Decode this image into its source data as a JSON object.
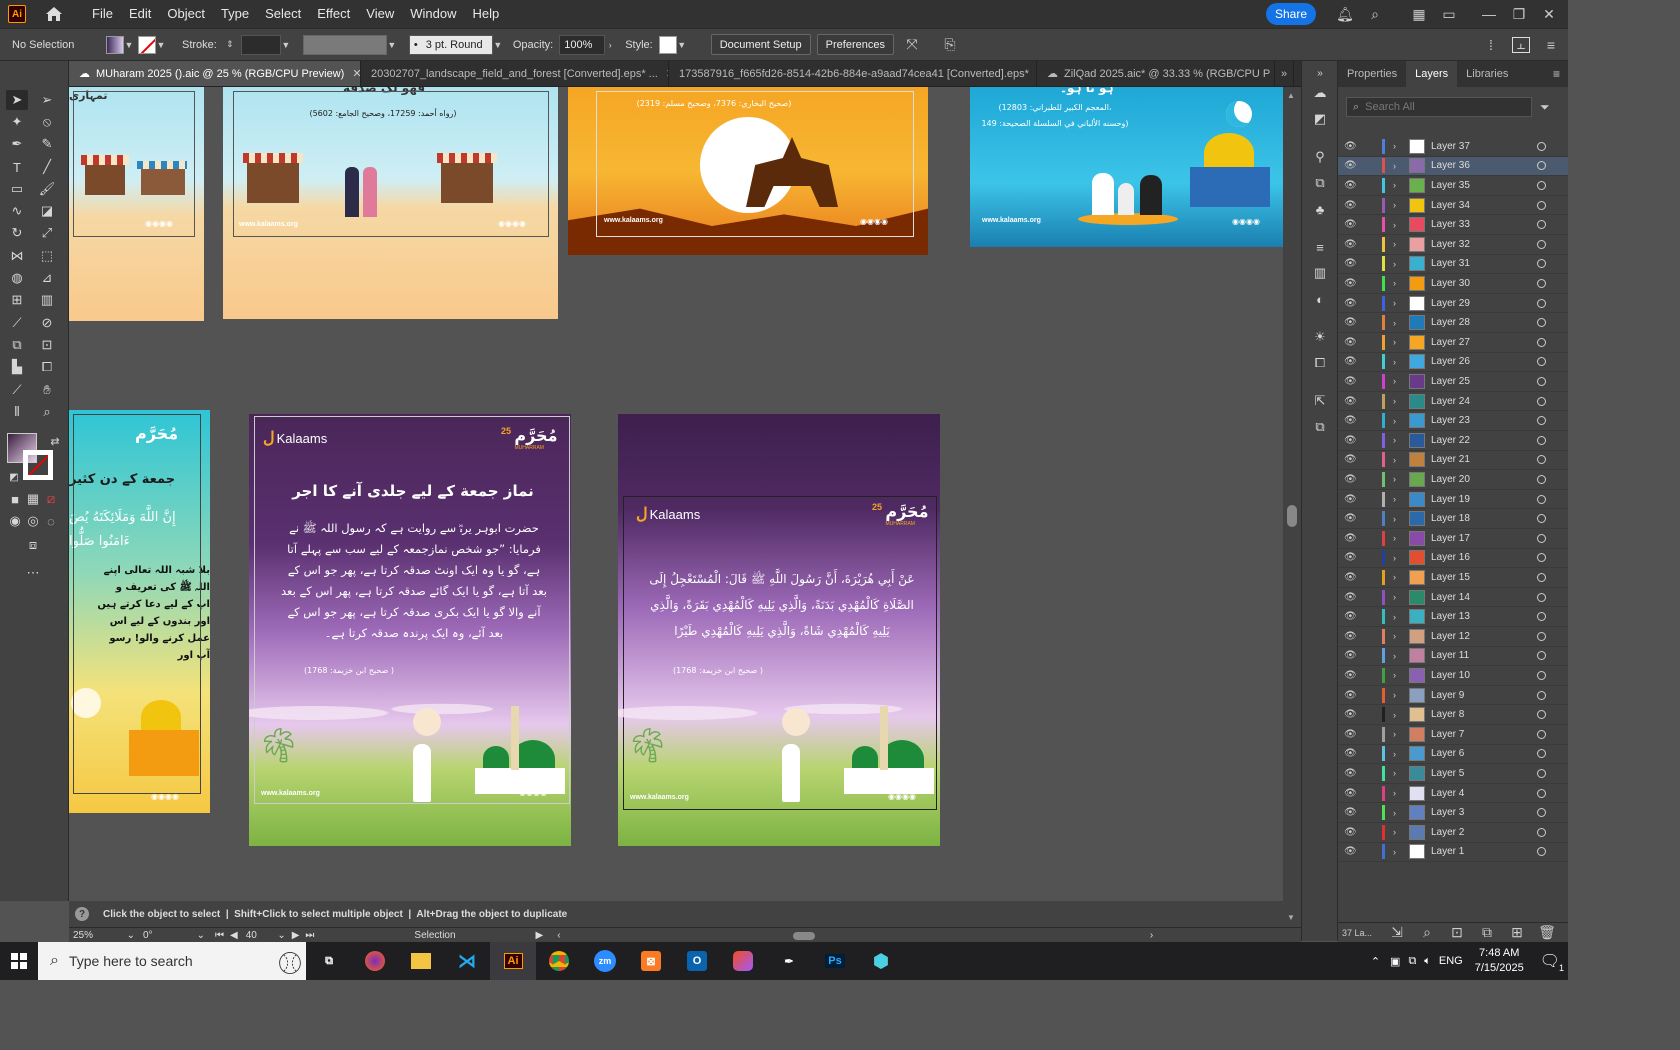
{
  "app": {
    "logo": "Ai",
    "menus": [
      "File",
      "Edit",
      "Object",
      "Type",
      "Select",
      "Effect",
      "View",
      "Window",
      "Help"
    ],
    "share_label": "Share"
  },
  "control_bar": {
    "selection": "No Selection",
    "stroke_label": "Stroke:",
    "brush_value": "3 pt. Round",
    "opacity_label": "Opacity:",
    "opacity_value": "100%",
    "style_label": "Style:",
    "document_setup": "Document Setup",
    "preferences": "Preferences"
  },
  "tabs": [
    {
      "label": "MUharam 2025 ().aic @ 25 % (RGB/CPU Preview)",
      "active": true
    },
    {
      "label": "20302707_landscape_field_and_forest [Converted].eps* ...",
      "active": false
    },
    {
      "label": "173587916_f665fd26-8514-42b6-884e-a9aad74cea41 [Converted].eps*",
      "active": false
    },
    {
      "label": "ZilQad 2025.aic* @ 33.33 % (RGB/CPU P",
      "active": false
    }
  ],
  "artboards": {
    "ab2_title": "فهو لک صدقة",
    "ab2_ref": "(رواه أحمد: 17259، وصحيح الجامع: 5602)",
    "ab1_title": "تمہاری",
    "ab3_ref": "(صحيح البخاري: 7376، وصحيح مسلم: 2319)",
    "ab4_title": "ہو تا ہو۔",
    "ab4_ref1": "(المعجم الكبير للطبراني: 12803،",
    "ab4_ref2": "وحسنه الألباني في السلسلة الصحيحة: 149)",
    "url": "www.kalaams.org",
    "brand": "Kalaams",
    "muharram": "مُحَرَّم",
    "muharram_sub": "MUHARRAM",
    "number": "25",
    "ab5_heading": "جمعة کے دن کثیر",
    "ab5_arabic1": "إِنَّ اللَّهَ وَمَلَائِكَتَهُ يُصَ",
    "ab5_arabic2": "ءَامَنُوا صَلُّوا",
    "ab5_body": "بلا شبہ اللہ تعالی اپنے\nاللہ ﷺ کی تعریف و\nاپ کے لیے دعا کرتے ہیں\nاور بندوں کے لیے اس\nعمل کرنے والو! رسو\nآپ اور",
    "ab6_heading": "نماز جمعة کے لیے جلدی آنے کا اجر",
    "ab6_body": "حضرت ابوہر یرہؓ سے روایت ہے کہ رسول اللہ ﷺ نے فرمایا: ”جو شخص نمازجمعہ کے لیے سب سے پہلے آتا ہے، گو یا وہ ایک اونٹ صدقہ کرتا ہے، پھر جو اس کے بعد آتا ہے، گو یا ایک گائے صدقہ کرتا ہے، پھر اس کے بعد آنے والا گو یا ایک بکری صدقہ کرتا ہے، پھر جو اس کے بعد آئے، وہ ایک پرندہ صدقہ کرتا ہے۔",
    "ab6_ref": "(صحيح ابن خزيمة: 1768 )",
    "ab7_arabic": "عَنْ أَبِي هُرَيْرَةَ، أَنَّ رَسُولَ اللَّهِ ﷺ قَالَ: الْمُسْتَعْجِلُ إِلَى الصَّلَاةِ كَالْمُهْدِي بَدَنَةً، وَالَّذِي يَلِيهِ كَالْمُهْدِي بَقَرَةً، وَالَّذِي يَلِيهِ كَالْمُهْدِي شَاةً، وَالَّذِي يَلِيهِ كَالْمُهْدِي طَيْرًا",
    "ab7_ref": "(صحيح ابن خزيمة: 1768 )"
  },
  "panel": {
    "tabs": [
      "Properties",
      "Layers",
      "Libraries"
    ],
    "active_tab": "Layers",
    "search_placeholder": "Search All",
    "layers": [
      {
        "name": "Layer 37",
        "color": "#4a7fe0"
      },
      {
        "name": "Layer 36",
        "color": "#e05050",
        "selected": true
      },
      {
        "name": "Layer 35",
        "color": "#40c8e0"
      },
      {
        "name": "Layer 34",
        "color": "#9b59b6"
      },
      {
        "name": "Layer 33",
        "color": "#e84fa8"
      },
      {
        "name": "Layer 32",
        "color": "#f0c040"
      },
      {
        "name": "Layer 31",
        "color": "#e0e040"
      },
      {
        "name": "Layer 30",
        "color": "#40e050"
      },
      {
        "name": "Layer 29",
        "color": "#4060e0"
      },
      {
        "name": "Layer 28",
        "color": "#e08040"
      },
      {
        "name": "Layer 27",
        "color": "#f0a030"
      },
      {
        "name": "Layer 26",
        "color": "#40d0d0"
      },
      {
        "name": "Layer 25",
        "color": "#d040d0"
      },
      {
        "name": "Layer 24",
        "color": "#c0a060"
      },
      {
        "name": "Layer 23",
        "color": "#30b0d0"
      },
      {
        "name": "Layer 22",
        "color": "#8060e0"
      },
      {
        "name": "Layer 21",
        "color": "#e06090"
      },
      {
        "name": "Layer 20",
        "color": "#70c070"
      },
      {
        "name": "Layer 19",
        "color": "#b0b0b0"
      },
      {
        "name": "Layer 18",
        "color": "#5080c0"
      },
      {
        "name": "Layer 17",
        "color": "#e04040"
      },
      {
        "name": "Layer 16",
        "color": "#2040a0"
      },
      {
        "name": "Layer 15",
        "color": "#e0a020"
      },
      {
        "name": "Layer 14",
        "color": "#9050c0"
      },
      {
        "name": "Layer 13",
        "color": "#30c0c0"
      },
      {
        "name": "Layer 12",
        "color": "#e08060"
      },
      {
        "name": "Layer 11",
        "color": "#60a0e0"
      },
      {
        "name": "Layer 10",
        "color": "#40a040"
      },
      {
        "name": "Layer 9",
        "color": "#e06030"
      },
      {
        "name": "Layer 8",
        "color": "#202020"
      },
      {
        "name": "Layer 7",
        "color": "#a0a0a0"
      },
      {
        "name": "Layer 6",
        "color": "#60c0e0"
      },
      {
        "name": "Layer 5",
        "color": "#40e0a0"
      },
      {
        "name": "Layer 4",
        "color": "#e04080"
      },
      {
        "name": "Layer 3",
        "color": "#50e050"
      },
      {
        "name": "Layer 2",
        "color": "#e03030"
      },
      {
        "name": "Layer 1",
        "color": "#4070d0"
      }
    ],
    "footer_count": "37 La..."
  },
  "hint": "Click the object to select  |  Shift+Click to select multiple object  |  Alt+Drag the object to duplicate",
  "status": {
    "zoom": "25%",
    "rotation": "0°",
    "artboard_num": "40",
    "tool": "Selection"
  },
  "taskbar": {
    "search_placeholder": "Type here to search",
    "time": "7:48 AM",
    "date": "7/15/2025",
    "notifications": "1"
  },
  "colors": {
    "accent": "#1473e6",
    "ai_orange": "#ff9a00",
    "purple_artboard": "#4a2a5a"
  }
}
